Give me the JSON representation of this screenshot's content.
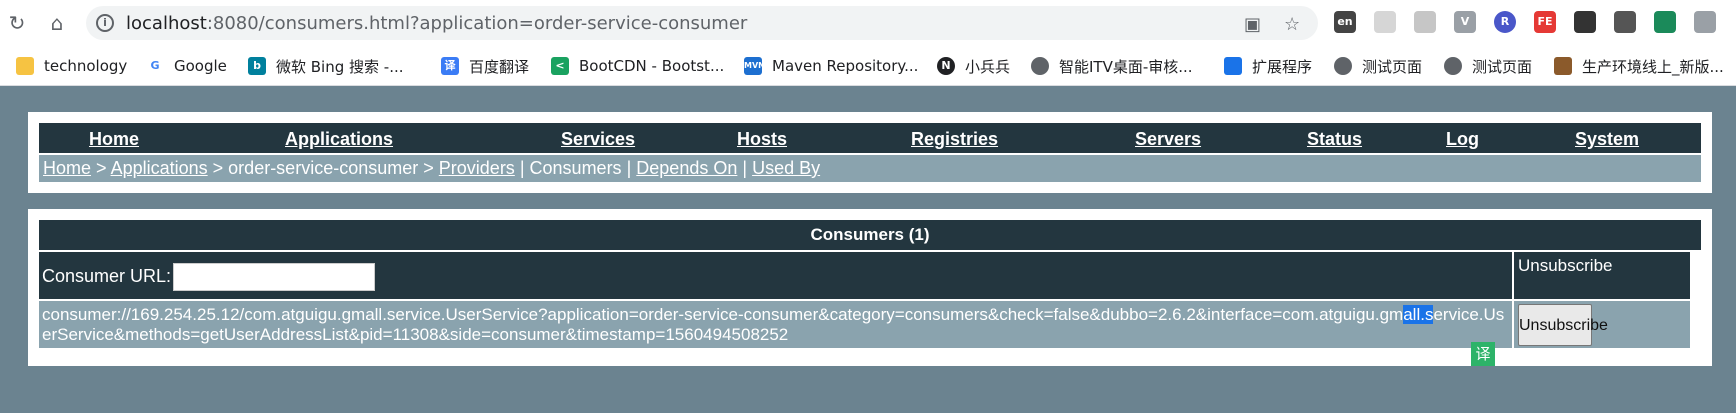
{
  "browser": {
    "url_host": "localhost",
    "url_rest": ":8080/consumers.html?application=order-service-consumer",
    "extensions": [
      "FE"
    ]
  },
  "bookmarks": [
    {
      "label": "technology",
      "icon": "folder-icon",
      "color": "#f6c342"
    },
    {
      "label": "Google",
      "icon": "google-icon",
      "color": "#4285f4"
    },
    {
      "label": "微软 Bing 搜索 -...",
      "icon": "bing-icon",
      "color": "#00809d"
    },
    {
      "label": "百度翻译",
      "icon": "baidu-translate-icon",
      "color": "#3b7cf5"
    },
    {
      "label": "BootCDN - Bootst...",
      "icon": "bootcdn-icon",
      "color": "#1aa260"
    },
    {
      "label": "Maven Repository...",
      "icon": "maven-icon",
      "color": "#1d6fd0"
    },
    {
      "label": "小兵兵",
      "icon": "notion-icon",
      "color": "#202124"
    },
    {
      "label": "智能ITV桌面-审核...",
      "icon": "globe-icon",
      "color": "#5f6368"
    },
    {
      "label": "扩展程序",
      "icon": "puzzle-icon",
      "color": "#1a73e8"
    },
    {
      "label": "测试页面",
      "icon": "globe-icon",
      "color": "#5f6368"
    },
    {
      "label": "测试页面",
      "icon": "globe-icon",
      "color": "#5f6368"
    },
    {
      "label": "生产环境线上_新版...",
      "icon": "image-icon",
      "color": "#8b5a2b"
    }
  ],
  "nav": {
    "items": [
      "Home",
      "Applications",
      "Services",
      "Hosts",
      "Registries",
      "Servers",
      "Status",
      "Log",
      "System"
    ]
  },
  "breadcrumb": {
    "home": "Home",
    "applications": "Applications",
    "app": "order-service-consumer",
    "providers": "Providers",
    "consumers": "Consumers",
    "depends_on": "Depends On",
    "used_by": "Used By",
    "sep_gt": ">",
    "sep_bar": "|"
  },
  "consumers": {
    "title": "Consumers (1)",
    "search_label": "Consumer URL:",
    "search_value": "",
    "unsubscribe_header": "Unsubscribe",
    "rows": [
      {
        "url_before": "consumer://169.254.25.12/com.atguigu.gmall.service.UserService?application=order-service-consumer&category=consumers&check=false&dubbo=2.6.2&interface=com.atguigu.gm",
        "url_selected": "all.s",
        "url_after": "ervice.UserService&methods=getUserAddressList&pid=11308&side=consumer&timestamp=1560494508252",
        "action": "Unsubscribe"
      }
    ]
  },
  "translate_badge": "译",
  "colors": {
    "page_bg": "#6b8390",
    "dark_bar": "#23363f",
    "light_bar": "#8aa3ae",
    "selection": "#1a73e8"
  }
}
